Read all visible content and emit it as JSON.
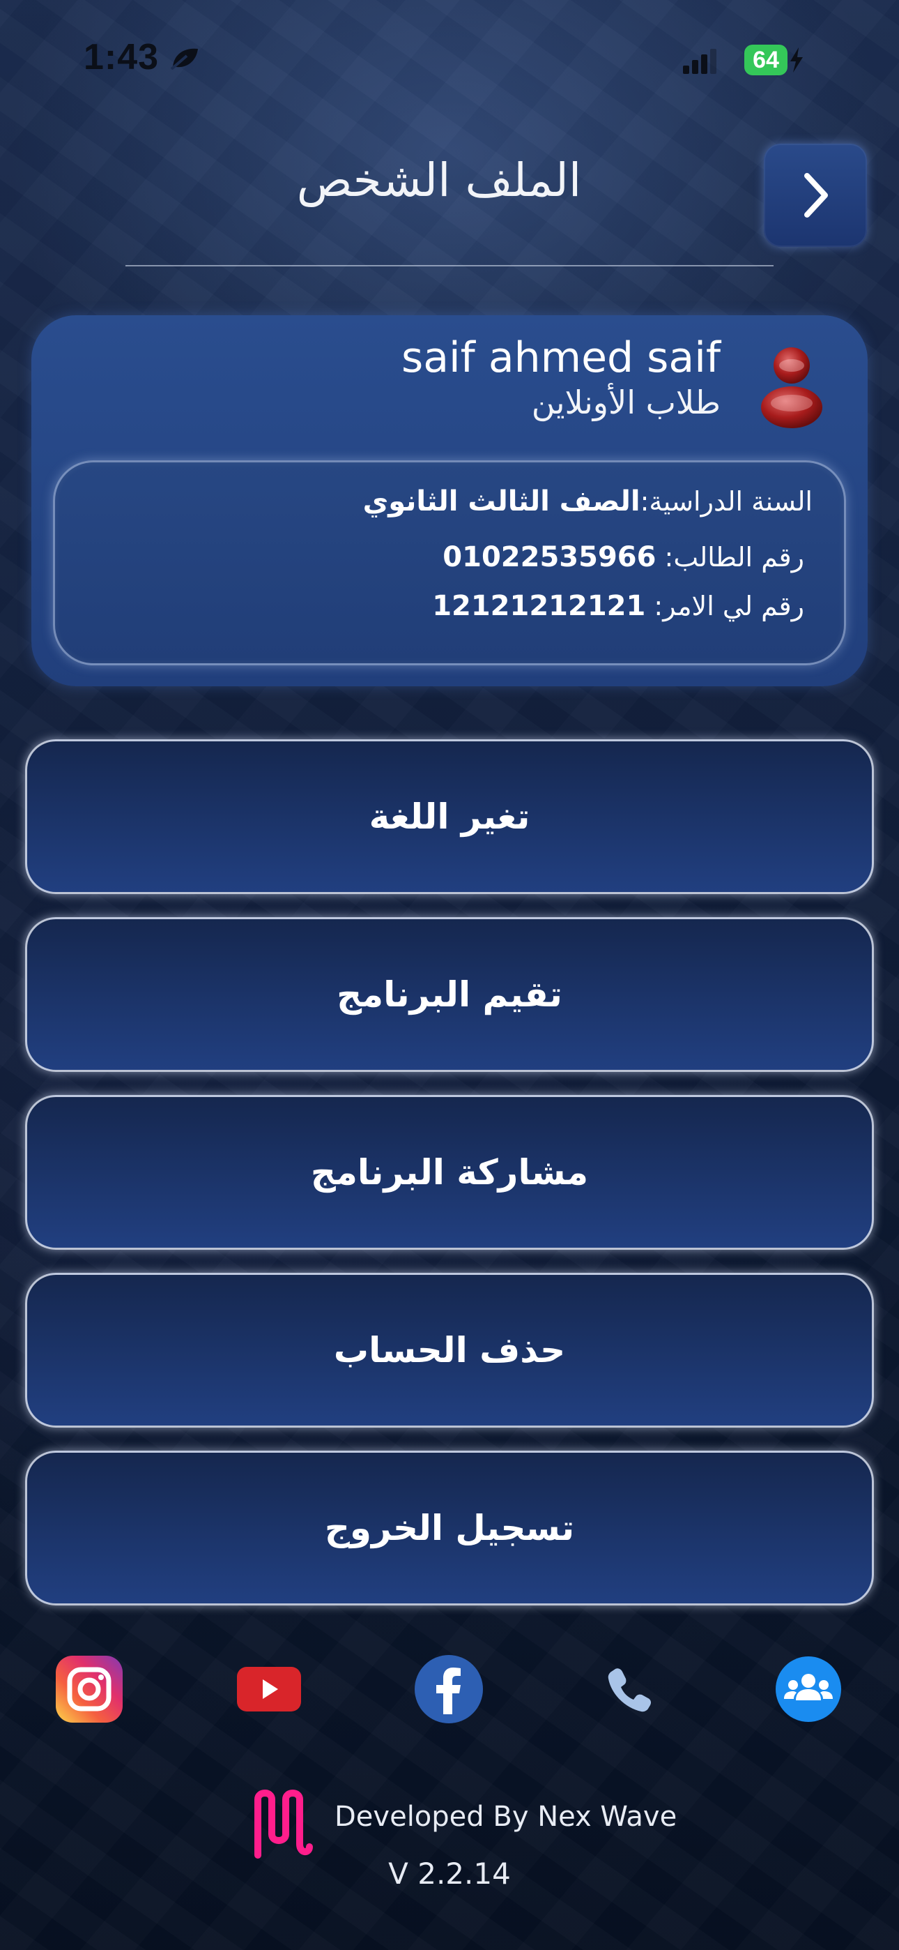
{
  "status_bar": {
    "time": "1:43",
    "battery_level": "64",
    "icons": [
      "leaf-icon",
      "signal-icon",
      "battery-icon",
      "charging-bolt-icon"
    ]
  },
  "header": {
    "title": "الملف الشخص",
    "back_icon": "chevron-right-icon"
  },
  "profile": {
    "avatar_icon": "user-avatar-icon",
    "name": "saif ahmed saif",
    "role": "طلاب الأونلاين",
    "academic_year_label": "السنة الدراسية:",
    "academic_year_value": "الصف الثالث الثانوي",
    "student_number_label": "رقم الطالب: ",
    "student_number_value": "01022535966",
    "parent_number_label": "رقم لي الامر: ",
    "parent_number_value": "12121212121"
  },
  "menu": {
    "change_language": "تغير اللغة",
    "rate_app": "تقيم البرنامج",
    "share_app": "مشاركة البرنامج",
    "delete_account": "حذف الحساب",
    "logout": "تسجيل الخروج"
  },
  "social": {
    "icons": [
      "instagram-icon",
      "youtube-icon",
      "facebook-icon",
      "phone-icon",
      "community-icon"
    ]
  },
  "footer": {
    "developer_text": "Developed By Nex Wave",
    "version": "V 2.2.14"
  },
  "colors": {
    "background": "#13223f",
    "card": "#2a4d8e",
    "button": "#1c3570",
    "battery": "#34c759",
    "logo": "#ff1e8c"
  }
}
